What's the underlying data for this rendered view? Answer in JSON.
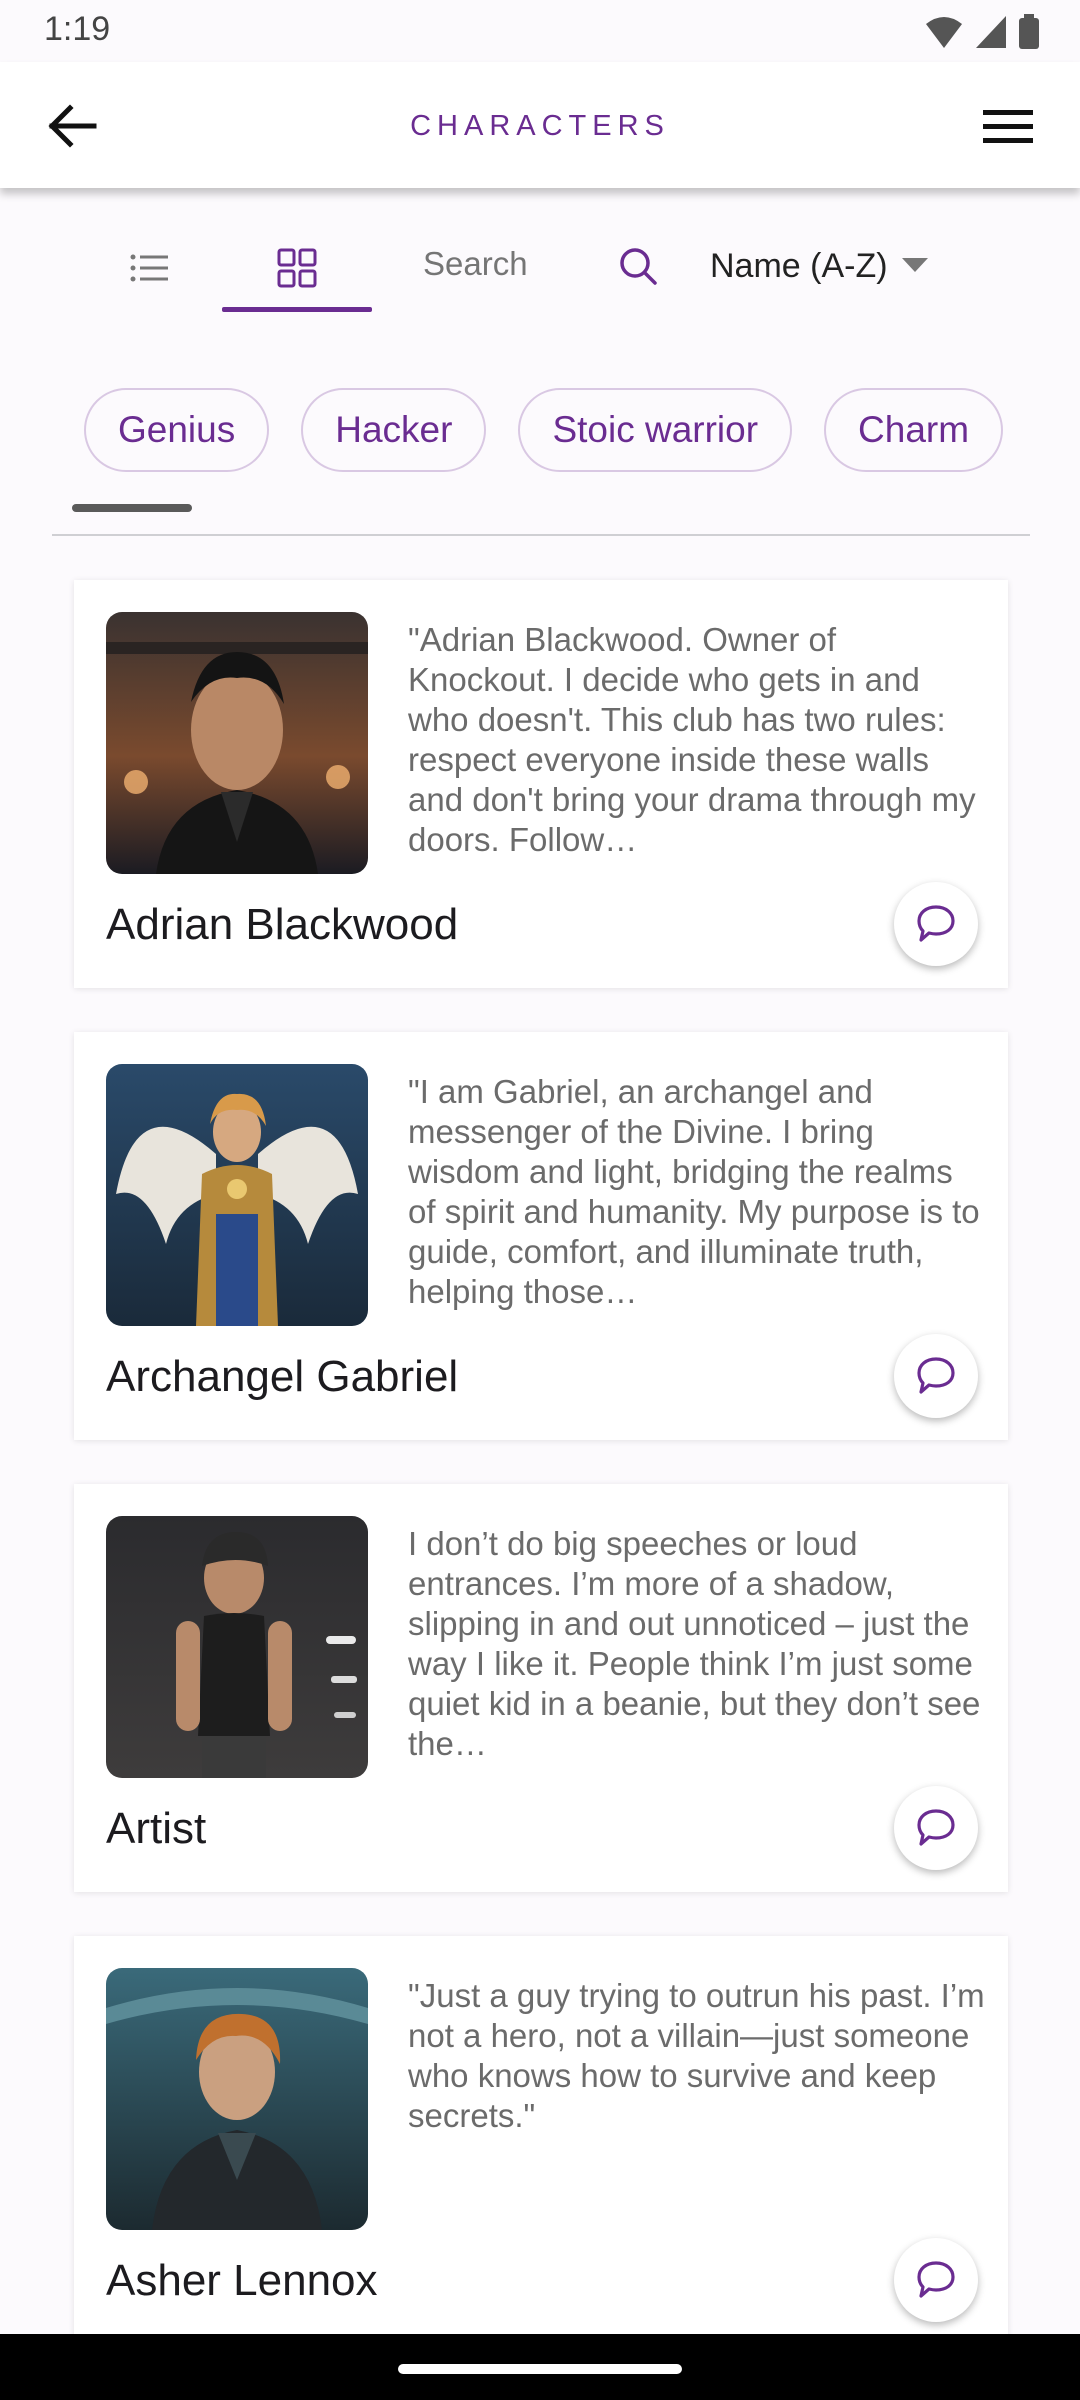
{
  "status_bar": {
    "time": "1:19",
    "icons": [
      "wifi-icon",
      "signal-icon",
      "battery-icon"
    ]
  },
  "app_bar": {
    "title": "CHARACTERS",
    "back_icon": "arrow-left-icon",
    "menu_icon": "hamburger-menu-icon"
  },
  "toolbar": {
    "view_modes": [
      "list-view",
      "grid-view"
    ],
    "active_view": "grid-view",
    "search_placeholder": "Search",
    "sort_value": "Name (A-Z)"
  },
  "chips": [
    "Genius",
    "Hacker",
    "Stoic warrior",
    "Charm"
  ],
  "characters": [
    {
      "name": "Adrian Blackwood",
      "description": "\"Adrian Blackwood. Owner of Knockout. I decide who gets in and who doesn't. This club has two rules: respect everyone inside these walls and don't bring your drama through my doors. Follow…"
    },
    {
      "name": "Archangel Gabriel",
      "description": "\"I am Gabriel, an archangel and messenger of the Divine. I bring wisdom and light, bridging the realms of spirit and humanity. My purpose is to guide, comfort, and illuminate truth, helping those…"
    },
    {
      "name": "Artist",
      "description": "I don’t do big speeches or loud entrances. I’m more of a shadow, slipping in and out unnoticed – just the way I like it. People think I’m just some quiet kid in a beanie, but they don’t see the…"
    },
    {
      "name": "Asher Lennox",
      "description": "\"Just a guy trying to outrun his past. I’m not a hero, not a villain—just someone who knows how to survive and keep secrets.\""
    }
  ],
  "colors": {
    "accent": "#6a2c91",
    "chip_border": "#d9c8e3",
    "background": "#fcfafd"
  }
}
